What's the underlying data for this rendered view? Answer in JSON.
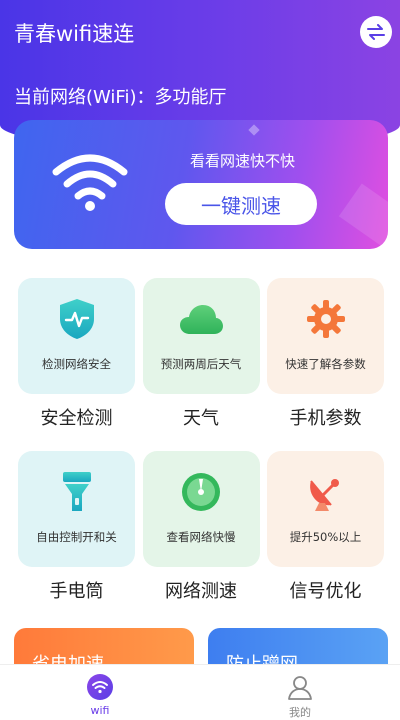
{
  "app": {
    "title": "青春wifi速连"
  },
  "header": {
    "network_label": "当前网络(WiFi)：多功能厅"
  },
  "banner": {
    "subtitle": "看看网速快不快",
    "button_label": "一键测速"
  },
  "grid": {
    "items": [
      {
        "title": "安全检测",
        "desc": "检测网络安全",
        "icon": "shield-icon"
      },
      {
        "title": "天气",
        "desc": "预测两周后天气",
        "icon": "cloud-icon"
      },
      {
        "title": "手机参数",
        "desc": "快速了解各参数",
        "icon": "gear-icon"
      },
      {
        "title": "手电筒",
        "desc": "自由控制开和关",
        "icon": "flashlight-icon"
      },
      {
        "title": "网络测速",
        "desc": "查看网络快慢",
        "icon": "speedometer-icon"
      },
      {
        "title": "信号优化",
        "desc": "提升50%以上",
        "icon": "satellite-dish-icon"
      }
    ]
  },
  "bottom_cards": {
    "left": "省电加速",
    "right": "防止蹭网"
  },
  "tabbar": {
    "tabs": [
      {
        "label": "wifi",
        "icon": "wifi-icon",
        "active": true
      },
      {
        "label": "我的",
        "icon": "user-icon",
        "active": false
      }
    ]
  },
  "colors": {
    "primary": "#6a3de8",
    "header_start": "#4a35e7",
    "banner_end": "#e14fe0"
  }
}
